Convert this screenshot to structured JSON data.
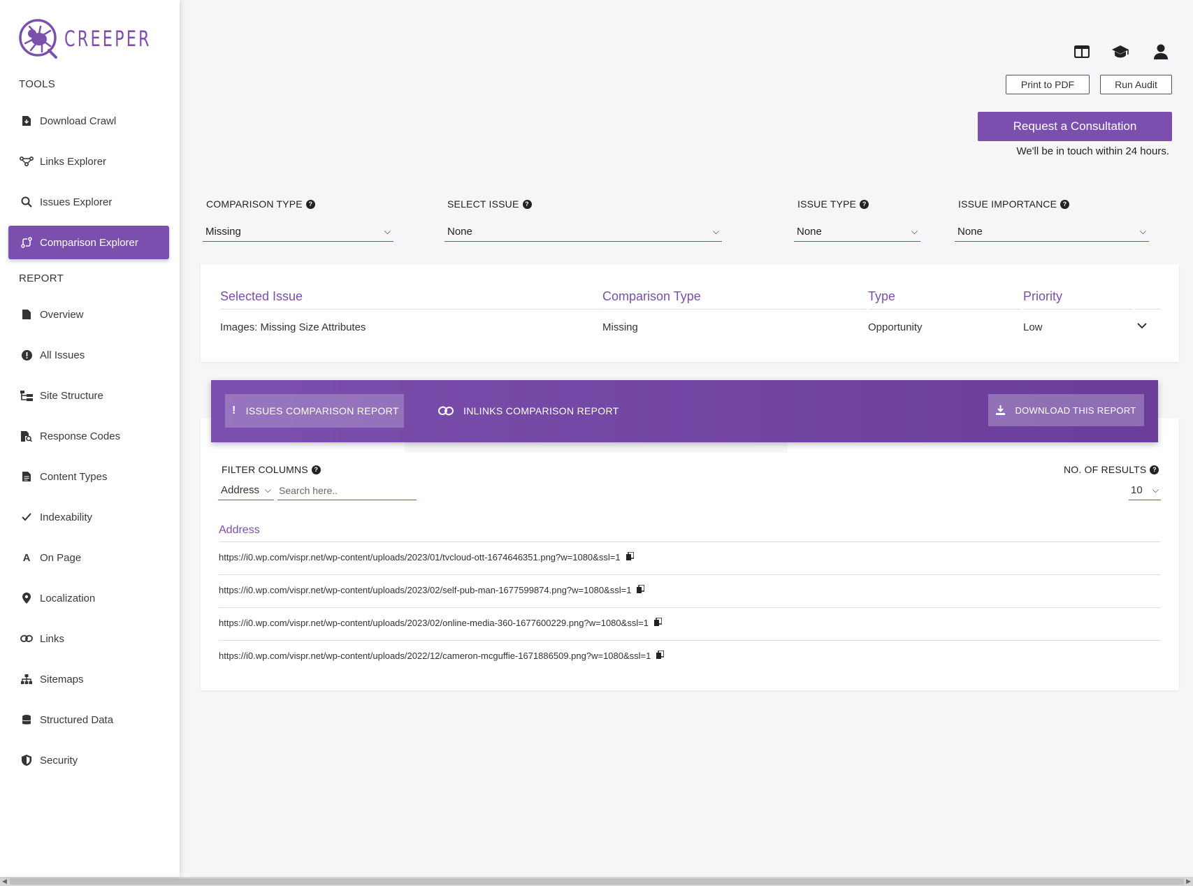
{
  "brand": {
    "name": "CREEPER",
    "accent": "#7b4fad"
  },
  "sidebar": {
    "tools_label": "TOOLS",
    "tools": [
      {
        "label": "Download Crawl",
        "icon": "file-download-icon"
      },
      {
        "label": "Links Explorer",
        "icon": "links-graph-icon"
      },
      {
        "label": "Issues Explorer",
        "icon": "search-icon"
      },
      {
        "label": "Comparison Explorer",
        "icon": "compare-icon",
        "active": true
      }
    ],
    "report_label": "REPORT",
    "report": [
      {
        "label": "Overview",
        "icon": "file-icon"
      },
      {
        "label": "All Issues",
        "icon": "alert-circle-icon"
      },
      {
        "label": "Site Structure",
        "icon": "tree-icon"
      },
      {
        "label": "Response Codes",
        "icon": "file-search-icon"
      },
      {
        "label": "Content Types",
        "icon": "file-text-icon"
      },
      {
        "label": "Indexability",
        "icon": "check-icon"
      },
      {
        "label": "On Page",
        "icon": "font-icon"
      },
      {
        "label": "Localization",
        "icon": "map-pin-icon"
      },
      {
        "label": "Links",
        "icon": "link-icon"
      },
      {
        "label": "Sitemaps",
        "icon": "sitemap-icon"
      },
      {
        "label": "Structured Data",
        "icon": "database-icon"
      },
      {
        "label": "Security",
        "icon": "shield-icon"
      }
    ]
  },
  "header": {
    "print_label": "Print to PDF",
    "run_audit_label": "Run Audit",
    "consult_label": "Request a Consultation",
    "consult_note": "We'll be in touch within 24 hours."
  },
  "filters": {
    "comparison_type": {
      "label": "COMPARISON TYPE",
      "value": "Missing"
    },
    "select_issue": {
      "label": "SELECT ISSUE",
      "value": "None"
    },
    "issue_type": {
      "label": "ISSUE TYPE",
      "value": "None"
    },
    "issue_importance": {
      "label": "ISSUE IMPORTANCE",
      "value": "None"
    }
  },
  "selected": {
    "headers": [
      "Selected Issue",
      "Comparison Type",
      "Type",
      "Priority"
    ],
    "row": [
      "Images: Missing Size Attributes",
      "Missing",
      "Opportunity",
      "Low"
    ]
  },
  "report": {
    "tab_issues": "ISSUES COMPARISON REPORT",
    "tab_inlinks": "INLINKS COMPARISON REPORT",
    "download_label": "DOWNLOAD THIS REPORT",
    "filter_columns_label": "FILTER COLUMNS",
    "column_value": "Address",
    "search_placeholder": "Search here..",
    "results_label": "NO. OF RESULTS",
    "results_value": "10",
    "table_header": "Address",
    "rows": [
      "https://i0.wp.com/vispr.net/wp-content/uploads/2023/01/tvcloud-ott-1674646351.png?w=1080&ssl=1",
      "https://i0.wp.com/vispr.net/wp-content/uploads/2023/02/self-pub-man-1677599874.png?w=1080&ssl=1",
      "https://i0.wp.com/vispr.net/wp-content/uploads/2023/02/online-media-360-1677600229.png?w=1080&ssl=1",
      "https://i0.wp.com/vispr.net/wp-content/uploads/2022/12/cameron-mcguffie-1671886509.png?w=1080&ssl=1"
    ]
  }
}
